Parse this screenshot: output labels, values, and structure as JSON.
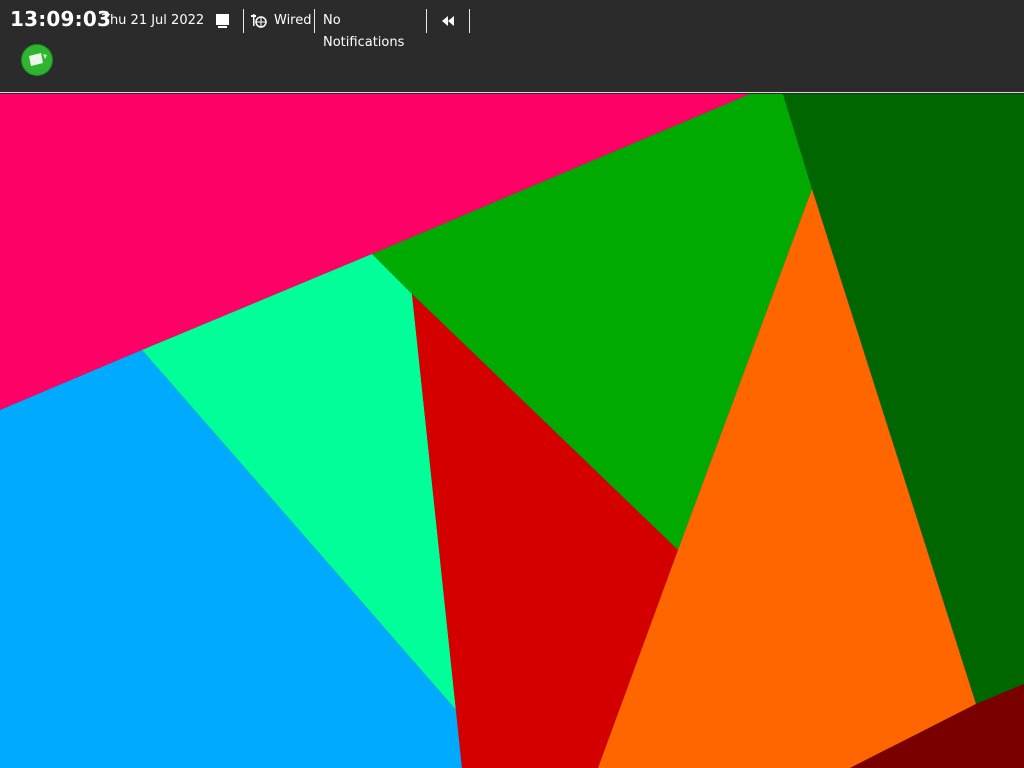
{
  "panel": {
    "clock": "13:09:03",
    "date": "Thu 21 Jul 2022",
    "show_desktop_icon": "window-icon",
    "network": {
      "icon": "wired-network-icon",
      "label": "Wired"
    },
    "notifications": {
      "label": "No Notifications"
    },
    "media": {
      "icon": "rewind-icon"
    }
  },
  "launcher": {
    "icon": "green-app-launcher-icon"
  },
  "wallpaper": {
    "colors": {
      "pink": "#ff0066",
      "green": "#00aa00",
      "dark_green": "#006600",
      "mint": "#00ff99",
      "blue": "#00aaff",
      "red": "#d40000",
      "orange": "#ff6600",
      "maroon": "#7a0000"
    }
  }
}
